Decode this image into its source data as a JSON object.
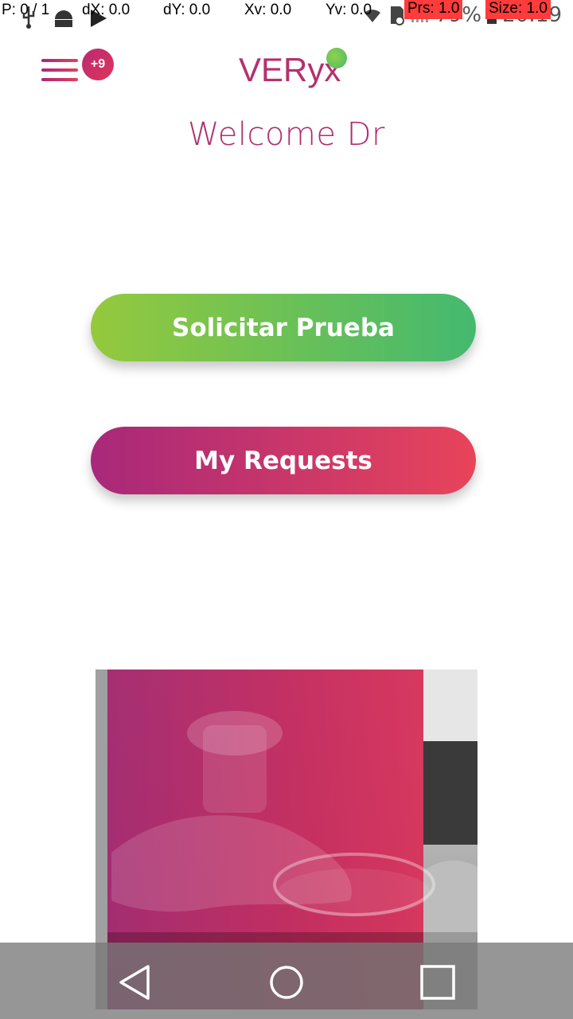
{
  "status_bar": {
    "overlay": {
      "pointer": "P: 0 / 1",
      "dx": "dX: 0.0",
      "dy": "dY: 0.0",
      "xv": "Xv: 0.0",
      "yv": "Yv: 0.0",
      "prs": "Prs: 1.0",
      "size": "Size: 1.0"
    },
    "battery_pct": "79%",
    "clock": "20:19",
    "icons": [
      "usb-icon",
      "android-debug-icon",
      "play-store-icon",
      "wifi-icon",
      "sd-card-icon",
      "signal-icon",
      "battery-icon"
    ]
  },
  "header": {
    "notification_badge": "+9",
    "logo_text": "VERyx",
    "menu_icon": "hamburger-menu-icon"
  },
  "welcome": "Welcome Dr",
  "actions": {
    "request_test": "Solicitar Prueba",
    "my_requests": "My Requests"
  },
  "hero_image": {
    "subject": "lab-glove-petri-dish-photo"
  },
  "nav_bar": {
    "back_icon": "back-triangle-icon",
    "home_icon": "home-circle-icon",
    "recents_icon": "recents-square-icon"
  },
  "colors": {
    "brand_pink": "#b02e6e",
    "brand_red": "#e8445a",
    "brand_green": "#44b96f",
    "brand_lime": "#95c93d"
  }
}
